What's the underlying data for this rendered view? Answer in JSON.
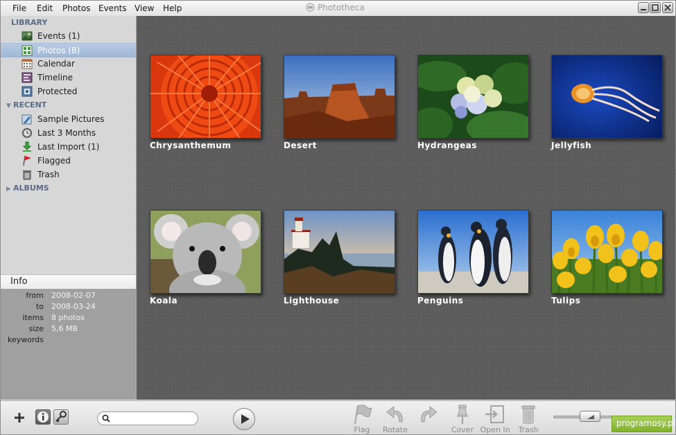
{
  "window": {
    "title": "Phototheca",
    "menu": [
      "File",
      "Edit",
      "Photos",
      "Events",
      "View",
      "Help"
    ]
  },
  "sidebar": {
    "library": {
      "label": "LIBRARY",
      "items": [
        {
          "label": "Events (1)",
          "icon": "events-icon"
        },
        {
          "label": "Photos (8)",
          "icon": "photos-icon",
          "selected": true
        },
        {
          "label": "Calendar",
          "icon": "calendar-icon"
        },
        {
          "label": "Timeline",
          "icon": "timeline-icon"
        },
        {
          "label": "Protected",
          "icon": "protected-icon"
        }
      ]
    },
    "recent": {
      "label": "RECENT",
      "items": [
        {
          "label": "Sample Pictures",
          "icon": "folder-pen-icon"
        },
        {
          "label": "Last 3 Months",
          "icon": "clock-icon"
        },
        {
          "label": "Last Import (1)",
          "icon": "import-arrow-icon"
        },
        {
          "label": "Flagged",
          "icon": "flag-icon"
        },
        {
          "label": "Trash",
          "icon": "trash-icon"
        }
      ]
    },
    "albums": {
      "label": "ALBUMS"
    }
  },
  "info": {
    "title": "Info",
    "rows": [
      {
        "key": "from",
        "value": "2008-02-07"
      },
      {
        "key": "to",
        "value": "2008-03-24"
      },
      {
        "key": "items",
        "value": "8 photos"
      },
      {
        "key": "size",
        "value": "5,6 MB"
      },
      {
        "key": "keywords",
        "value": ""
      }
    ]
  },
  "photos": [
    {
      "caption": "Chrysanthemum"
    },
    {
      "caption": "Desert"
    },
    {
      "caption": "Hydrangeas"
    },
    {
      "caption": "Jellyfish"
    },
    {
      "caption": "Koala"
    },
    {
      "caption": "Lighthouse"
    },
    {
      "caption": "Penguins"
    },
    {
      "caption": "Tulips"
    }
  ],
  "toolbar": {
    "search": {
      "placeholder": "",
      "value": ""
    },
    "tools": [
      {
        "label": "Flag",
        "icon": "flag-icon"
      },
      {
        "label": "Rotate",
        "icon": "rotate-left-icon"
      },
      {
        "label": "",
        "icon": "rotate-right-icon"
      },
      {
        "label": "Cover",
        "icon": "pin-icon"
      },
      {
        "label": "Open In",
        "icon": "open-in-icon"
      },
      {
        "label": "Trash",
        "icon": "trash-icon"
      }
    ],
    "zoom": 0.48
  },
  "watermark": {
    "text": "programosy.pl"
  },
  "colors": {
    "selection": "#a9bfdc",
    "section_header": "#5a6b85",
    "canvas": "#5b5b5b",
    "watermark": "#8fc23b"
  }
}
